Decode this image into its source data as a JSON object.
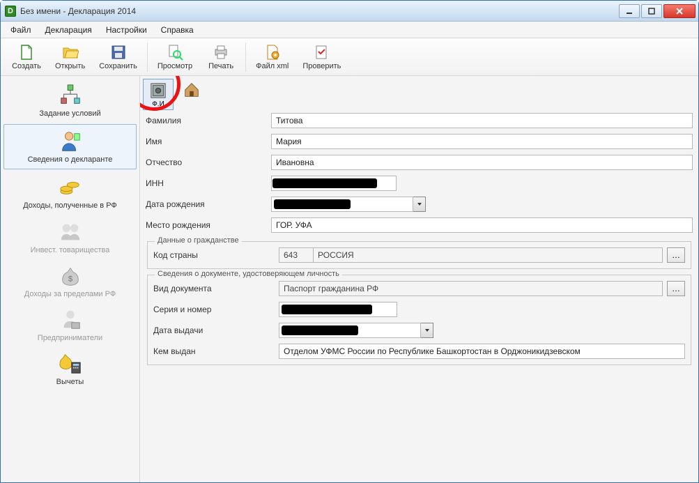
{
  "window": {
    "title": "Без имени - Декларация 2014"
  },
  "menu": {
    "file": "Файл",
    "decl": "Декларация",
    "settings": "Настройки",
    "help": "Справка"
  },
  "toolbar": {
    "create": "Создать",
    "open": "Открыть",
    "save": "Сохранить",
    "preview": "Просмотр",
    "print": "Печать",
    "xml": "Файл xml",
    "check": "Проверить"
  },
  "sidebar": {
    "conditions": "Задание условий",
    "declarant": "Сведения о декларанте",
    "income_rf": "Доходы, полученные в РФ",
    "invest": "Инвест. товарищества",
    "income_foreign": "Доходы за пределами РФ",
    "entrepreneur": "Предприниматели",
    "deductions": "Вычеты"
  },
  "mode": {
    "fio": "Ф.И"
  },
  "form": {
    "surname_label": "Фамилия",
    "surname": "Титова",
    "name_label": "Имя",
    "name": "Мария",
    "patronymic_label": "Отчество",
    "patronymic": "Ивановна",
    "inn_label": "ИНН",
    "inn": "",
    "dob_label": "Дата рождения",
    "dob": "",
    "birthplace_label": "Место рождения",
    "birthplace": "ГОР. УФА"
  },
  "citizenship": {
    "legend": "Данные о гражданстве",
    "code_label": "Код страны",
    "code": "643",
    "country": "РОССИЯ"
  },
  "identity": {
    "legend": "Сведения о документе, удостоверяющем личность",
    "doctype_label": "Вид документа",
    "doctype": "Паспорт гражданина РФ",
    "series_label": "Серия и номер",
    "series": "",
    "issue_date_label": "Дата выдачи",
    "issue_date": "",
    "issued_by_label": "Кем выдан",
    "issued_by": "Отделом УФМС России по Республике Башкортостан в Орджоникидзевском"
  }
}
